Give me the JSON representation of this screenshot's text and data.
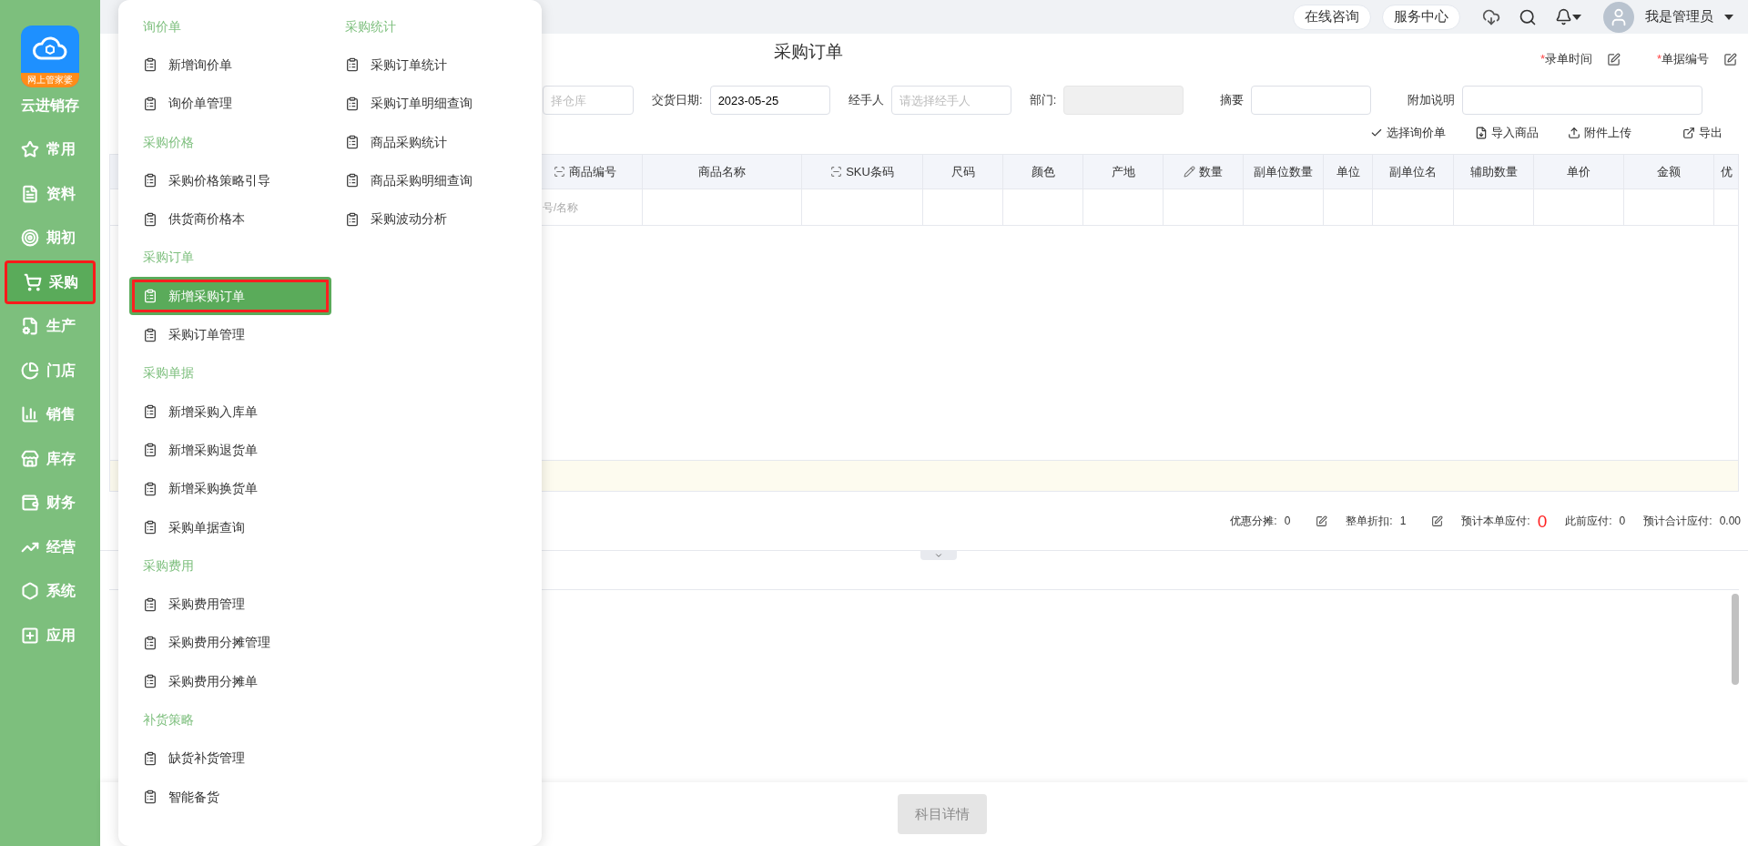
{
  "sidebar": {
    "logo_badge": "网上管家婆",
    "app_name": "云进销存",
    "items": [
      {
        "label": "常用",
        "kind": "star",
        "selected": false
      },
      {
        "label": "资料",
        "kind": "document",
        "selected": false
      },
      {
        "label": "期初",
        "kind": "target",
        "selected": false
      },
      {
        "label": "采购",
        "kind": "cart",
        "selected": true
      },
      {
        "label": "生产",
        "kind": "production",
        "selected": false
      },
      {
        "label": "门店",
        "kind": "pie",
        "selected": false
      },
      {
        "label": "销售",
        "kind": "chart",
        "selected": false
      },
      {
        "label": "库存",
        "kind": "store",
        "selected": false
      },
      {
        "label": "财务",
        "kind": "wallet",
        "selected": false
      },
      {
        "label": "经营",
        "kind": "trend",
        "selected": false
      },
      {
        "label": "系统",
        "kind": "settings",
        "selected": false
      },
      {
        "label": "应用",
        "kind": "plus",
        "selected": false
      }
    ]
  },
  "top_bar": {
    "buttons": [
      "在线咨询",
      "服务中心"
    ],
    "user": "我是管理员"
  },
  "page": {
    "title": "采购订单",
    "header_fields": [
      {
        "marker": "*",
        "label": "录单时间"
      },
      {
        "marker": "*",
        "label": "单据编号"
      }
    ],
    "form": {
      "warehouse": {
        "placeholder": "择仓库"
      },
      "delivery_date": {
        "label": "交货日期:",
        "value": "2023-05-25"
      },
      "handler": {
        "label": "经手人",
        "placeholder": "请选择经手人"
      },
      "department": {
        "label": "部门:",
        "disabled": true
      },
      "summary": {
        "label": "摘要"
      },
      "note": {
        "label": "附加说明"
      }
    },
    "toolbar": [
      {
        "label": "选择询价单",
        "kind": "check"
      },
      {
        "label": "导入商品",
        "kind": "import"
      },
      {
        "label": "附件上传",
        "kind": "upload"
      },
      {
        "label": "导出",
        "kind": "export"
      }
    ],
    "table": {
      "columns": [
        {
          "label": "商品编号",
          "kind": "scan"
        },
        {
          "label": "商品名称",
          "kind": "plain"
        },
        {
          "label": "SKU条码",
          "kind": "scan"
        },
        {
          "label": "尺码",
          "kind": "plain"
        },
        {
          "label": "颜色",
          "kind": "plain"
        },
        {
          "label": "产地",
          "kind": "plain"
        },
        {
          "label": "数量",
          "kind": "edit"
        },
        {
          "label": "副单位数量",
          "kind": "plain"
        },
        {
          "label": "单位",
          "kind": "plain"
        },
        {
          "label": "副单位名",
          "kind": "plain"
        },
        {
          "label": "辅助数量",
          "kind": "plain"
        },
        {
          "label": "单价",
          "kind": "plain"
        },
        {
          "label": "金额",
          "kind": "plain"
        },
        {
          "label": "优",
          "kind": "plain"
        }
      ],
      "entry_placeholder": "号/名称"
    },
    "totals": [
      {
        "label": "优惠分摊:",
        "value": "0",
        "editable": true,
        "kind": "plain"
      },
      {
        "label": "整单折扣:",
        "value": "1",
        "editable": true,
        "kind": "plain"
      },
      {
        "label": "预计本单应付:",
        "value": "0",
        "editable": false,
        "kind": "highlight"
      },
      {
        "label": "此前应付:",
        "value": "0",
        "editable": false,
        "kind": "plain"
      },
      {
        "label": "预计合计应付:",
        "value": "0.00",
        "editable": false,
        "kind": "plain"
      }
    ],
    "detail_button": {
      "label": "科目详情",
      "disabled": true
    }
  },
  "menu": {
    "columns": [
      {
        "sections": [
          {
            "title": "询价单",
            "items": [
              {
                "label": "新增询价单",
                "selected": false
              },
              {
                "label": "询价单管理",
                "selected": false
              }
            ]
          },
          {
            "title": "采购价格",
            "items": [
              {
                "label": "采购价格策略引导",
                "selected": false
              },
              {
                "label": "供货商价格本",
                "selected": false
              }
            ]
          },
          {
            "title": "采购订单",
            "items": [
              {
                "label": "新增采购订单",
                "selected": true
              },
              {
                "label": "采购订单管理",
                "selected": false
              }
            ]
          },
          {
            "title": "采购单据",
            "items": [
              {
                "label": "新增采购入库单",
                "selected": false
              },
              {
                "label": "新增采购退货单",
                "selected": false
              },
              {
                "label": "新增采购换货单",
                "selected": false
              },
              {
                "label": "采购单据查询",
                "selected": false
              }
            ]
          },
          {
            "title": "采购费用",
            "items": [
              {
                "label": "采购费用管理",
                "selected": false
              },
              {
                "label": "采购费用分摊管理",
                "selected": false
              },
              {
                "label": "采购费用分摊单",
                "selected": false
              }
            ]
          },
          {
            "title": "补货策略",
            "items": [
              {
                "label": "缺货补货管理",
                "selected": false
              },
              {
                "label": "智能备货",
                "selected": false
              }
            ]
          }
        ]
      },
      {
        "sections": [
          {
            "title": "采购统计",
            "items": [
              {
                "label": "采购订单统计",
                "selected": false
              },
              {
                "label": "采购订单明细查询",
                "selected": false
              },
              {
                "label": "商品采购统计",
                "selected": false
              },
              {
                "label": "商品采购明细查询",
                "selected": false
              },
              {
                "label": "采购波动分析",
                "selected": false
              }
            ]
          }
        ]
      }
    ]
  }
}
